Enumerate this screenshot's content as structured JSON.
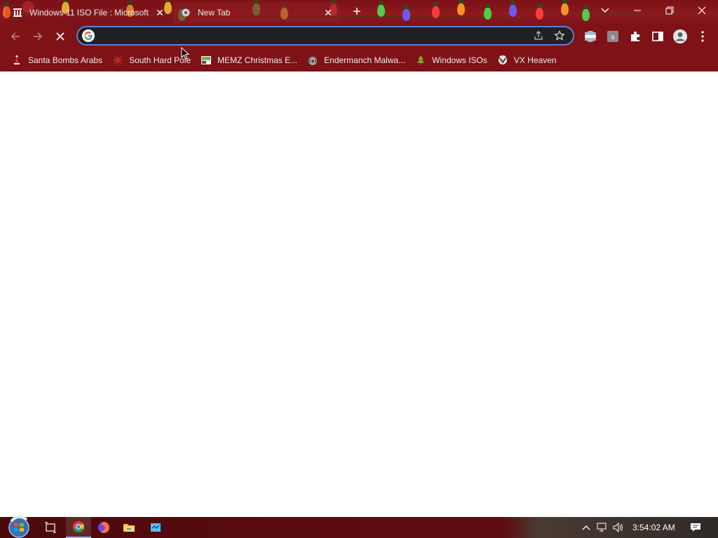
{
  "browser": {
    "tabs": [
      {
        "title": "Windows 11 ISO File : Microsoft",
        "icon": "archive-org-icon",
        "active": false
      },
      {
        "title": "New Tab",
        "icon": "chrome-newtab-icon",
        "active": true
      }
    ],
    "window_controls": [
      "tab-search",
      "minimize",
      "restore",
      "close"
    ]
  },
  "toolbar": {
    "address_value": "",
    "address_placeholder": "",
    "accent_color": "#8ab4f8"
  },
  "bookmarks": [
    {
      "label": "Santa Bombs Arabs",
      "icon": "santa-icon"
    },
    {
      "label": "South Hard Pole",
      "icon": "snowflake-icon"
    },
    {
      "label": "MEMZ Christmas E...",
      "icon": "memz-icon"
    },
    {
      "label": "Endermanch Malwa...",
      "icon": "raccoon-icon"
    },
    {
      "label": "Windows ISOs",
      "icon": "tree-icon"
    },
    {
      "label": "VX Heaven",
      "icon": "vx-heaven-icon"
    }
  ],
  "taskbar": {
    "apps": [
      "task-view",
      "chrome",
      "firefox",
      "file-explorer",
      "notepad"
    ],
    "clock": "3:54:02 AM"
  },
  "theme": {
    "frame_color": "#7e1217",
    "omnibox_color": "#202124"
  }
}
